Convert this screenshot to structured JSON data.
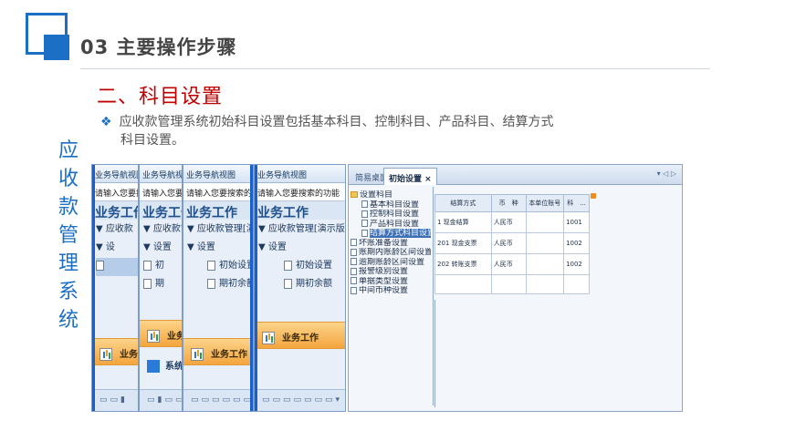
{
  "header": {
    "title": "03  主要操作步骤"
  },
  "section": {
    "title": "二、科目设置",
    "bullet_line1": "应收款管理系统初始科目设置包括基本科目、控制科目、产品科目、结算方式",
    "bullet_line2": "科目设置。"
  },
  "side_title": [
    "应",
    "收",
    "款",
    "管",
    "理",
    "系",
    "统"
  ],
  "panels": [
    {
      "title": "业务导航视图",
      "search": "请输入您要搜",
      "head": "业务工作",
      "tree": [
        "▼  应收款",
        "▼  设",
        "",
        ""
      ],
      "orange": "业务",
      "lower": "",
      "toolbar": "▭▭▮"
    },
    {
      "title": "业务导航视图",
      "search": "请输入您要搜索的",
      "head": "业务工作",
      "tree": [
        "▼  应收款管",
        "▼  设置",
        "初",
        "期"
      ],
      "orange": "业务工",
      "lower": "系统服",
      "toolbar": "▭▮▭▭"
    },
    {
      "title": "业务导航视图",
      "search": "请输入您要搜索的功能",
      "head": "业务工作",
      "tree": [
        "▼  应收款管理[演示",
        "▼  设置",
        "初始设置",
        "期初余额"
      ],
      "orange": "业务工作",
      "lower": "",
      "toolbar": "▭▭▭▭▭▭"
    },
    {
      "title": "业务导航视图",
      "search": "请输入您要搜索的功能",
      "head": "业务工作",
      "tree": [
        "▼  应收款管理[演示版]",
        "▼  设置",
        "初始设置",
        "期初余额"
      ],
      "orange": "业务工作",
      "lower": "",
      "toolbar": "▭▭▭▭▭▭▭▾"
    }
  ],
  "right": {
    "tabs": [
      "简易桌面",
      "初始设置"
    ],
    "close": "×",
    "ctrl": "▾ ◁ ▷",
    "tree": [
      {
        "label": "设置科目",
        "type": "folder",
        "indent": 0
      },
      {
        "label": "基本科目设置",
        "type": "doc",
        "indent": 1
      },
      {
        "label": "控制科目设置",
        "type": "doc",
        "indent": 1
      },
      {
        "label": "产品科目设置",
        "type": "doc",
        "indent": 1
      },
      {
        "label": "结算方式科目设置",
        "type": "doc",
        "indent": 1,
        "selected": true
      },
      {
        "label": "坏账准备设置",
        "type": "doc",
        "indent": 0
      },
      {
        "label": "账期内账龄区间设置",
        "type": "doc",
        "indent": 0
      },
      {
        "label": "逾期账龄区间设置",
        "type": "doc",
        "indent": 0
      },
      {
        "label": "报警级别设置",
        "type": "doc",
        "indent": 0
      },
      {
        "label": "单据类型设置",
        "type": "doc",
        "indent": 0
      },
      {
        "label": "中间币种设置",
        "type": "doc",
        "indent": 0
      }
    ],
    "grid": {
      "headers": [
        "结算方式",
        "币　种",
        "本单位账号",
        "科　..."
      ],
      "rows": [
        [
          "1  现金结算",
          "人民币",
          "",
          "1001"
        ],
        [
          "201  现金支票",
          "人民币",
          "",
          "1002"
        ],
        [
          "202  转账支票",
          "人民币",
          "",
          "1002"
        ]
      ]
    }
  }
}
